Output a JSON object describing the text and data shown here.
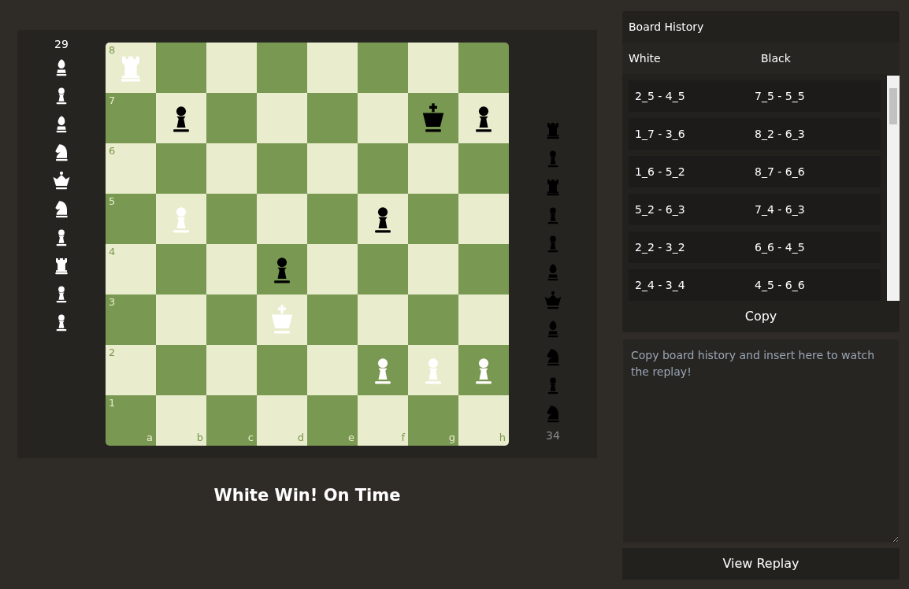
{
  "captured_left": {
    "count": "29",
    "pieces": [
      {
        "kind": "bishop",
        "color": "#ffffff"
      },
      {
        "kind": "pawn",
        "color": "#ffffff"
      },
      {
        "kind": "bishop",
        "color": "#ffffff"
      },
      {
        "kind": "knight",
        "color": "#ffffff"
      },
      {
        "kind": "queen",
        "color": "#ffffff"
      },
      {
        "kind": "knight",
        "color": "#ffffff"
      },
      {
        "kind": "pawn",
        "color": "#ffffff"
      },
      {
        "kind": "rook",
        "color": "#ffffff"
      },
      {
        "kind": "pawn",
        "color": "#ffffff"
      },
      {
        "kind": "pawn",
        "color": "#ffffff"
      }
    ]
  },
  "captured_right": {
    "count": "34",
    "pieces": [
      {
        "kind": "rook",
        "color": "#000000"
      },
      {
        "kind": "pawn",
        "color": "#000000"
      },
      {
        "kind": "rook",
        "color": "#000000"
      },
      {
        "kind": "pawn",
        "color": "#000000"
      },
      {
        "kind": "pawn",
        "color": "#000000"
      },
      {
        "kind": "bishop",
        "color": "#000000"
      },
      {
        "kind": "queen",
        "color": "#000000"
      },
      {
        "kind": "bishop",
        "color": "#000000"
      },
      {
        "kind": "knight",
        "color": "#000000"
      },
      {
        "kind": "pawn",
        "color": "#000000"
      },
      {
        "kind": "knight",
        "color": "#000000"
      }
    ]
  },
  "board": {
    "file_labels": [
      "a",
      "b",
      "c",
      "d",
      "e",
      "f",
      "g",
      "h"
    ],
    "ranks": [
      {
        "label": "8",
        "squares": [
          {
            "kind": "rook",
            "color": "#ffffff"
          },
          {
            "kind": "empty"
          },
          {
            "kind": "empty"
          },
          {
            "kind": "empty"
          },
          {
            "kind": "empty"
          },
          {
            "kind": "empty"
          },
          {
            "kind": "empty"
          },
          {
            "kind": "empty"
          }
        ]
      },
      {
        "label": "7",
        "squares": [
          {
            "kind": "empty"
          },
          {
            "kind": "pawn",
            "color": "#000000"
          },
          {
            "kind": "empty"
          },
          {
            "kind": "empty"
          },
          {
            "kind": "empty"
          },
          {
            "kind": "empty"
          },
          {
            "kind": "king",
            "color": "#000000"
          },
          {
            "kind": "pawn",
            "color": "#000000"
          }
        ]
      },
      {
        "label": "6",
        "squares": [
          {
            "kind": "empty"
          },
          {
            "kind": "empty"
          },
          {
            "kind": "empty"
          },
          {
            "kind": "empty"
          },
          {
            "kind": "empty"
          },
          {
            "kind": "empty"
          },
          {
            "kind": "empty"
          },
          {
            "kind": "empty"
          }
        ]
      },
      {
        "label": "5",
        "squares": [
          {
            "kind": "empty"
          },
          {
            "kind": "pawn",
            "color": "#ffffff"
          },
          {
            "kind": "empty"
          },
          {
            "kind": "empty"
          },
          {
            "kind": "empty"
          },
          {
            "kind": "pawn",
            "color": "#000000"
          },
          {
            "kind": "empty"
          },
          {
            "kind": "empty"
          }
        ]
      },
      {
        "label": "4",
        "squares": [
          {
            "kind": "empty"
          },
          {
            "kind": "empty"
          },
          {
            "kind": "empty"
          },
          {
            "kind": "pawn",
            "color": "#000000"
          },
          {
            "kind": "empty"
          },
          {
            "kind": "empty"
          },
          {
            "kind": "empty"
          },
          {
            "kind": "empty"
          }
        ]
      },
      {
        "label": "3",
        "squares": [
          {
            "kind": "empty"
          },
          {
            "kind": "empty"
          },
          {
            "kind": "empty"
          },
          {
            "kind": "king",
            "color": "#ffffff"
          },
          {
            "kind": "empty"
          },
          {
            "kind": "empty"
          },
          {
            "kind": "empty"
          },
          {
            "kind": "empty"
          }
        ]
      },
      {
        "label": "2",
        "squares": [
          {
            "kind": "empty"
          },
          {
            "kind": "empty"
          },
          {
            "kind": "empty"
          },
          {
            "kind": "empty"
          },
          {
            "kind": "empty"
          },
          {
            "kind": "pawn",
            "color": "#ffffff"
          },
          {
            "kind": "pawn",
            "color": "#ffffff"
          },
          {
            "kind": "pawn",
            "color": "#ffffff"
          }
        ]
      },
      {
        "label": "1",
        "squares": [
          {
            "kind": "empty"
          },
          {
            "kind": "empty"
          },
          {
            "kind": "empty"
          },
          {
            "kind": "empty"
          },
          {
            "kind": "empty"
          },
          {
            "kind": "empty"
          },
          {
            "kind": "empty"
          },
          {
            "kind": "empty"
          }
        ]
      }
    ]
  },
  "result": "White Win! On Time",
  "history": {
    "title": "Board History",
    "columns": [
      "White",
      "Black"
    ],
    "rows": [
      [
        "2_5 - 4_5",
        "7_5 - 5_5"
      ],
      [
        "1_7 - 3_6",
        "8_2 - 6_3"
      ],
      [
        "1_6 - 5_2",
        "8_7 - 6_6"
      ],
      [
        "5_2 - 6_3",
        "7_4 - 6_3"
      ],
      [
        "2_2 - 3_2",
        "6_6 - 4_5"
      ],
      [
        "2_4 - 3_4",
        "4_5 - 6_6"
      ]
    ],
    "copy_button": "Copy"
  },
  "replay_input": {
    "placeholder": "Copy board history and insert here to watch the replay!"
  },
  "replay_button": "View Replay"
}
